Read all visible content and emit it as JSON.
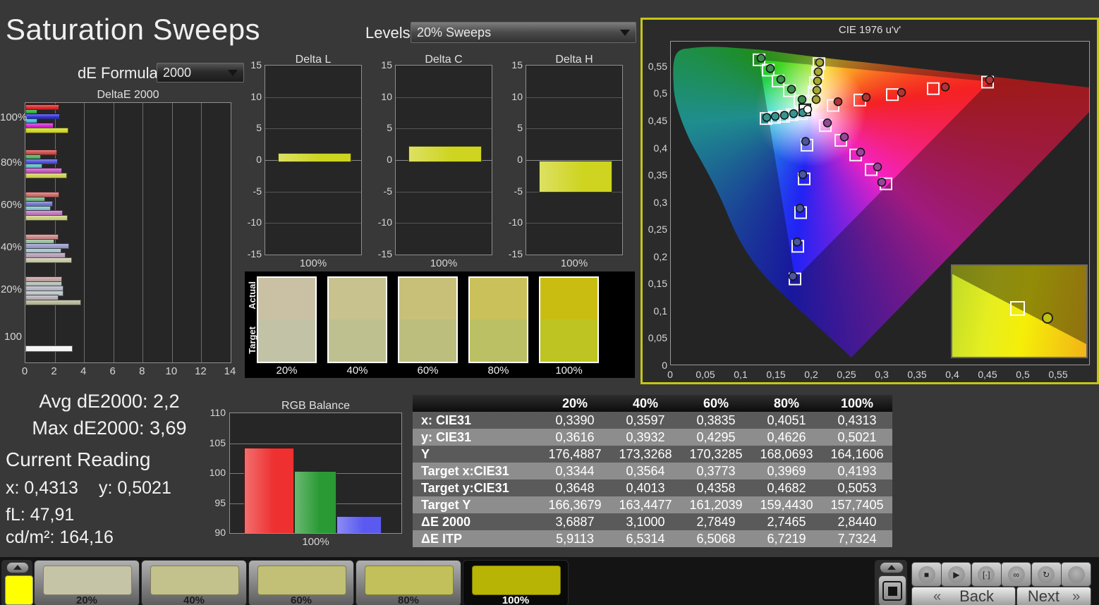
{
  "app": {
    "title": "Saturation Sweeps"
  },
  "controls": {
    "de_formula_label": "dE Formula:",
    "de_formula_value": "2000",
    "levels_label": "Levels:",
    "levels_value": "20% Sweeps"
  },
  "summary": {
    "avg": "Avg dE2000: 2,2",
    "max": "Max dE2000: 3,69"
  },
  "current_reading": {
    "heading": "Current Reading",
    "x_label": "x: 0,4313",
    "y_label": "y: 0,5021",
    "fl_label": "fL: 47,91",
    "cd_label": "cd/m²: 164,16"
  },
  "chart_data": [
    {
      "id": "deltae2000",
      "type": "bar",
      "orientation": "horizontal",
      "title": "DeltaE 2000",
      "categories": [
        "100%",
        "80%",
        "60%",
        "40%",
        "20%",
        "100"
      ],
      "series_labels": [
        "red",
        "green",
        "blue",
        "cyan",
        "magenta",
        "yellow"
      ],
      "groups": [
        {
          "label": "100%",
          "values": [
            2.2,
            0.7,
            2.25,
            0.7,
            1.85,
            2.85
          ],
          "colors": [
            "#d42424",
            "#21a52e",
            "#2d2dd8",
            "#2db6ca",
            "#ca21ca",
            "#ced41f"
          ]
        },
        {
          "label": "80%",
          "values": [
            2.05,
            0.95,
            2.1,
            1.05,
            2.4,
            2.75
          ],
          "colors": [
            "#d04545",
            "#44aa55",
            "#4d4dd0",
            "#50b8c6",
            "#c24fc2",
            "#cbce4e"
          ]
        },
        {
          "label": "60%",
          "values": [
            2.2,
            1.25,
            1.8,
            1.65,
            2.45,
            2.8
          ],
          "colors": [
            "#cb6565",
            "#68b078",
            "#7070ca",
            "#76bcc5",
            "#bb74bb",
            "#c8ca78"
          ]
        },
        {
          "label": "40%",
          "values": [
            2.15,
            1.9,
            2.9,
            2.35,
            2.65,
            3.1
          ],
          "colors": [
            "#c68585",
            "#8fb698",
            "#9595c6",
            "#9cc0c4",
            "#b599b5",
            "#c5c6a0"
          ]
        },
        {
          "label": "20%",
          "values": [
            2.4,
            2.4,
            2.5,
            2.5,
            2.15,
            3.7
          ],
          "colors": [
            "#c09d9d",
            "#aabab0",
            "#b2b2c2",
            "#b6c2c1",
            "#b3aab3",
            "#b2b294"
          ]
        },
        {
          "label": "100",
          "values": [
            3.15
          ],
          "colors": [
            "#f4f4f4"
          ]
        }
      ],
      "xlim": [
        0,
        14
      ],
      "xticks": [
        0,
        2,
        4,
        6,
        8,
        10,
        12,
        14
      ]
    },
    {
      "id": "delta_l",
      "type": "bar",
      "title": "Delta L",
      "categories": [
        "100%"
      ],
      "values": [
        1.2
      ],
      "ylim": [
        -15,
        15
      ],
      "yticks": [
        15,
        10,
        5,
        0,
        -5,
        -10,
        -15
      ],
      "bar_color": "#ced41f"
    },
    {
      "id": "delta_c",
      "type": "bar",
      "title": "Delta C",
      "categories": [
        "100%"
      ],
      "values": [
        2.3
      ],
      "ylim": [
        -15,
        15
      ],
      "yticks": [
        15,
        10,
        5,
        0,
        -5,
        -10,
        -15
      ],
      "bar_color": "#ced41f"
    },
    {
      "id": "delta_h",
      "type": "bar",
      "title": "Delta H",
      "categories": [
        "100%"
      ],
      "values": [
        -4.8
      ],
      "ylim": [
        -15,
        15
      ],
      "yticks": [
        15,
        10,
        5,
        0,
        -5,
        -10,
        -15
      ],
      "bar_color": "#ced41f"
    },
    {
      "id": "rgb_balance",
      "type": "bar",
      "title": "RGB Balance",
      "categories": [
        "100%"
      ],
      "series": [
        {
          "name": "red",
          "value": 104.2,
          "color": "#ee3030"
        },
        {
          "name": "green",
          "value": 100.4,
          "color": "#2a9a35"
        },
        {
          "name": "blue",
          "value": 92.8,
          "color": "#5a5af0"
        }
      ],
      "ylim": [
        90,
        110
      ],
      "yticks": [
        110,
        105,
        100,
        95,
        90
      ]
    },
    {
      "id": "cie1976",
      "type": "scatter",
      "title": "CIE 1976 u'v'",
      "xlim": [
        0,
        0.595
      ],
      "ylim": [
        0,
        0.5966
      ],
      "xticks": [
        0,
        0.05,
        0.1,
        0.15,
        0.2,
        0.25,
        0.3,
        0.35,
        0.4,
        0.45,
        0.5,
        0.55
      ],
      "xtick_labels": [
        "0",
        "0,05",
        "0,1",
        "0,15",
        "0,2",
        "0,25",
        "0,3",
        "0,35",
        "0,4",
        "0,45",
        "0,5",
        "0,55"
      ],
      "yticks": [
        0.55,
        0.5,
        0.45,
        0.4,
        0.35,
        0.3,
        0.25,
        0.2,
        0.15,
        0.1,
        0.05,
        0
      ],
      "ytick_labels": [
        "0,55",
        "0,5",
        "0,45",
        "0,4",
        "0,35",
        "0,3",
        "0,25",
        "0,2",
        "0,15",
        "0,1",
        "0,05",
        "0"
      ],
      "gamut_triangle": [
        [
          0.452,
          0.523
        ],
        [
          0.125,
          0.563
        ],
        [
          0.176,
          0.16
        ]
      ],
      "white_target": [
        0.19,
        0.471
      ],
      "white_measured": [
        0.194,
        0.472
      ],
      "sweeps": [
        {
          "name": "red",
          "color": "#b03434",
          "targets": [
            [
              0.23,
              0.479
            ],
            [
              0.268,
              0.489
            ],
            [
              0.314,
              0.499
            ],
            [
              0.372,
              0.51
            ],
            [
              0.449,
              0.522
            ]
          ],
          "measured": [
            [
              0.237,
              0.486
            ],
            [
              0.277,
              0.494
            ],
            [
              0.327,
              0.503
            ],
            [
              0.389,
              0.513
            ],
            [
              0.452,
              0.526
            ]
          ]
        },
        {
          "name": "green",
          "color": "#3f8f52",
          "targets": [
            [
              0.183,
              0.487
            ],
            [
              0.168,
              0.506
            ],
            [
              0.152,
              0.524
            ],
            [
              0.138,
              0.544
            ],
            [
              0.125,
              0.563
            ]
          ],
          "measured": [
            [
              0.186,
              0.49
            ],
            [
              0.171,
              0.509
            ],
            [
              0.156,
              0.527
            ],
            [
              0.141,
              0.547
            ],
            [
              0.128,
              0.566
            ]
          ]
        },
        {
          "name": "blue",
          "color": "#4a569e",
          "targets": [
            [
              0.193,
              0.406
            ],
            [
              0.189,
              0.344
            ],
            [
              0.184,
              0.282
            ],
            [
              0.18,
              0.22
            ],
            [
              0.176,
              0.16
            ]
          ],
          "measured": [
            [
              0.191,
              0.413
            ],
            [
              0.187,
              0.352
            ],
            [
              0.183,
              0.29
            ],
            [
              0.179,
              0.228
            ],
            [
              0.173,
              0.165
            ]
          ]
        },
        {
          "name": "cyan",
          "color": "#37958f",
          "targets": [
            [
              0.185,
              0.464
            ],
            [
              0.172,
              0.462
            ],
            [
              0.16,
              0.459
            ],
            [
              0.147,
              0.457
            ],
            [
              0.135,
              0.455
            ]
          ],
          "measured": [
            [
              0.187,
              0.466
            ],
            [
              0.174,
              0.464
            ],
            [
              0.161,
              0.461
            ],
            [
              0.148,
              0.459
            ],
            [
              0.136,
              0.457
            ]
          ]
        },
        {
          "name": "magenta",
          "color": "#97479b",
          "targets": [
            [
              0.219,
              0.442
            ],
            [
              0.241,
              0.415
            ],
            [
              0.262,
              0.388
            ],
            [
              0.284,
              0.361
            ],
            [
              0.305,
              0.335
            ]
          ],
          "measured": [
            [
              0.222,
              0.447
            ],
            [
              0.246,
              0.421
            ],
            [
              0.269,
              0.393
            ],
            [
              0.293,
              0.366
            ],
            [
              0.299,
              0.338
            ]
          ]
        },
        {
          "name": "yellow",
          "color": "#a8a832",
          "targets": [
            [
              0.2,
              0.487
            ],
            [
              0.203,
              0.504
            ],
            [
              0.205,
              0.521
            ],
            [
              0.208,
              0.539
            ],
            [
              0.21,
              0.556
            ]
          ],
          "measured": [
            [
              0.206,
              0.49
            ],
            [
              0.207,
              0.507
            ],
            [
              0.208,
              0.524
            ],
            [
              0.209,
              0.541
            ],
            [
              0.211,
              0.558
            ]
          ]
        }
      ],
      "inset": {
        "target": [
          0.47,
          0.44
        ],
        "measured": [
          0.69,
          0.55
        ],
        "marker_color": "#c2c210"
      }
    }
  ],
  "swatch_panel": {
    "row_labels": [
      "Actual",
      "Target"
    ],
    "columns": [
      {
        "label": "20%",
        "actual": "#cac1a5",
        "target": "#c2c2a7"
      },
      {
        "label": "40%",
        "actual": "#c7c28e",
        "target": "#bfc090"
      },
      {
        "label": "60%",
        "actual": "#c8c079",
        "target": "#bcbe7d"
      },
      {
        "label": "80%",
        "actual": "#cbc15a",
        "target": "#bcc064"
      },
      {
        "label": "100%",
        "actual": "#c9bd12",
        "target": "#bec522"
      }
    ]
  },
  "table": {
    "columns": [
      "20%",
      "40%",
      "60%",
      "80%",
      "100%"
    ],
    "rows": [
      {
        "label": "x: CIE31",
        "values": [
          "0,3390",
          "0,3597",
          "0,3835",
          "0,4051",
          "0,4313"
        ]
      },
      {
        "label": "y: CIE31",
        "values": [
          "0,3616",
          "0,3932",
          "0,4295",
          "0,4626",
          "0,5021"
        ]
      },
      {
        "label": "Y",
        "values": [
          "176,4887",
          "173,3268",
          "170,3285",
          "168,0693",
          "164,1606"
        ]
      },
      {
        "label": "Target x:CIE31",
        "values": [
          "0,3344",
          "0,3564",
          "0,3773",
          "0,3969",
          "0,4193"
        ]
      },
      {
        "label": "Target y:CIE31",
        "values": [
          "0,3648",
          "0,4013",
          "0,4358",
          "0,4682",
          "0,5053"
        ]
      },
      {
        "label": "Target Y",
        "values": [
          "166,3679",
          "163,4477",
          "161,2039",
          "159,4430",
          "157,7405"
        ]
      },
      {
        "label": "ΔE 2000",
        "values": [
          "3,6887",
          "3,1000",
          "2,7849",
          "2,7465",
          "2,8440"
        ]
      },
      {
        "label": "ΔE ITP",
        "values": [
          "5,9113",
          "6,5314",
          "6,5068",
          "6,7219",
          "7,7324"
        ]
      }
    ]
  },
  "bottom_bar": {
    "left_swatch_color": "#ffff00",
    "patches": [
      {
        "label": "20%",
        "color": "#c6c4a6",
        "selected": false
      },
      {
        "label": "40%",
        "color": "#c3c28d",
        "selected": false
      },
      {
        "label": "60%",
        "color": "#c2c077",
        "selected": false
      },
      {
        "label": "80%",
        "color": "#c2c05a",
        "selected": false
      },
      {
        "label": "100%",
        "color": "#b7b405",
        "selected": true
      }
    ],
    "transport": [
      {
        "name": "stop",
        "glyph": "■"
      },
      {
        "name": "play",
        "glyph": "▶"
      },
      {
        "name": "measure",
        "glyph": "[·]"
      },
      {
        "name": "continuous",
        "glyph": "∞"
      },
      {
        "name": "refresh",
        "glyph": "↻"
      },
      {
        "name": "extra",
        "glyph": ""
      }
    ],
    "back_glyph": "«",
    "back_label": "Back",
    "next_label": "Next",
    "next_glyph": "»"
  },
  "accent_color": "#c6c614"
}
